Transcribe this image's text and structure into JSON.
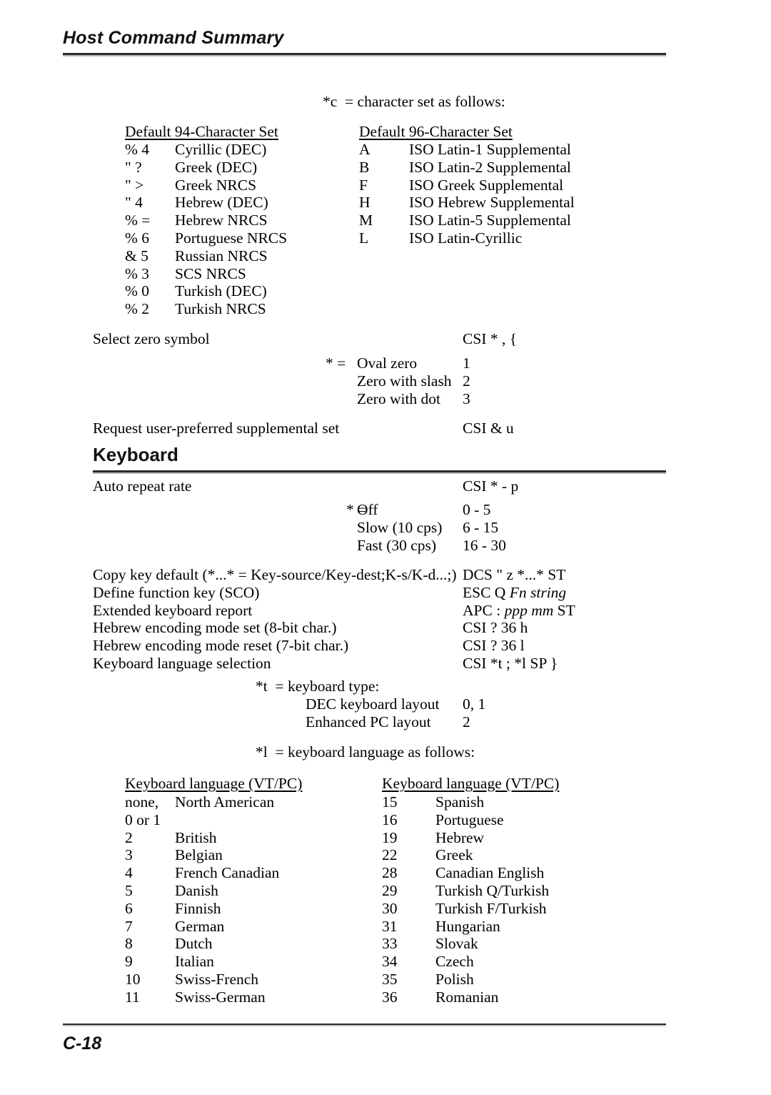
{
  "header": {
    "title": "Host Command Summary"
  },
  "footer": {
    "page_number": "C-18"
  },
  "charset_intro": "*c  = character set as follows:",
  "charset_table": {
    "left_header": "Default 94-Character Set",
    "right_header": "Default 96-Character Set",
    "left_rows": [
      {
        "code": "% 4",
        "name": "Cyrillic (DEC)"
      },
      {
        "code": "\" ?",
        "name": "Greek (DEC)"
      },
      {
        "code": "\" >",
        "name": "Greek NRCS"
      },
      {
        "code": "\" 4",
        "name": "Hebrew (DEC)"
      },
      {
        "code": "% =",
        "name": "Hebrew NRCS"
      },
      {
        "code": "% 6",
        "name": "Portuguese NRCS"
      },
      {
        "code": "& 5",
        "name": "Russian NRCS"
      },
      {
        "code": "% 3",
        "name": "SCS NRCS"
      },
      {
        "code": "% 0",
        "name": "Turkish (DEC)"
      },
      {
        "code": "% 2",
        "name": "Turkish NRCS"
      }
    ],
    "right_rows": [
      {
        "code": "A",
        "name": "ISO Latin-1 Supplemental"
      },
      {
        "code": "B",
        "name": "ISO Latin-2 Supplemental"
      },
      {
        "code": "F",
        "name": "ISO Greek Supplemental"
      },
      {
        "code": "H",
        "name": "ISO Hebrew Supplemental"
      },
      {
        "code": "M",
        "name": "ISO Latin-5 Supplemental"
      },
      {
        "code": "L",
        "name": "ISO Latin-Cyrillic"
      }
    ]
  },
  "zero_symbol": {
    "label": "Select zero symbol",
    "code": "CSI * , {",
    "options": [
      {
        "marker": "* =",
        "label": "Oval zero",
        "value": "1"
      },
      {
        "marker": "",
        "label": "Zero with slash",
        "value": "2"
      },
      {
        "marker": "",
        "label": "Zero with dot",
        "value": "3"
      }
    ]
  },
  "request_supplemental": {
    "label": "Request user-preferred supplemental set",
    "code": "CSI & u"
  },
  "keyboard_section": {
    "heading": "Keyboard",
    "auto_repeat": {
      "label": "Auto repeat rate",
      "code": "CSI * - p",
      "options": [
        {
          "marker": "* =",
          "label": "Off",
          "value": "0 - 5"
        },
        {
          "marker": "",
          "label": "Slow (10 cps)",
          "value": "6 - 15"
        },
        {
          "marker": "",
          "label": "Fast (30 cps)",
          "value": "16 - 30"
        }
      ]
    },
    "commands": [
      {
        "label": "Copy key default (*...* = Key-source/Key-dest;K-s/K-d...;)",
        "code": "DCS \" z *...* ST",
        "code_italic": ""
      },
      {
        "label": "Define function key (SCO)",
        "code": "ESC Q ",
        "code_italic": "Fn string"
      },
      {
        "label": "Extended keyboard report",
        "code": "APC : ",
        "code_italic": "ppp mm",
        "code_tail": " ST"
      },
      {
        "label": "Hebrew encoding mode set (8-bit char.)",
        "code": "CSI ? 36 h",
        "code_italic": ""
      },
      {
        "label": "Hebrew encoding mode reset (7-bit char.)",
        "code": "CSI ? 36 l",
        "code_italic": ""
      },
      {
        "label": "Keyboard language selection",
        "code": "CSI *t ; *l SP }",
        "code_italic": ""
      }
    ],
    "keyboard_type": {
      "intro": "*t  = keyboard type:",
      "rows": [
        {
          "label": "DEC keyboard layout",
          "value": "0, 1"
        },
        {
          "label": "Enhanced PC layout",
          "value": "2"
        }
      ]
    },
    "language_intro": "*l  = keyboard language as follows:",
    "language_table": {
      "left_header": "Keyboard language (VT/PC)",
      "right_header": "Keyboard language (VT/PC)",
      "left_rows": [
        {
          "code": "none,",
          "name": "North American"
        },
        {
          "code": "0 or 1",
          "name": ""
        },
        {
          "code": "2",
          "name": "British"
        },
        {
          "code": "3",
          "name": "Belgian"
        },
        {
          "code": "4",
          "name": "French Canadian"
        },
        {
          "code": "5",
          "name": "Danish"
        },
        {
          "code": "6",
          "name": "Finnish"
        },
        {
          "code": "7",
          "name": "German"
        },
        {
          "code": "8",
          "name": "Dutch"
        },
        {
          "code": "9",
          "name": "Italian"
        },
        {
          "code": "10",
          "name": "Swiss-French"
        },
        {
          "code": "11",
          "name": "Swiss-German"
        }
      ],
      "right_rows": [
        {
          "code": "15",
          "name": "Spanish"
        },
        {
          "code": "16",
          "name": "Portuguese"
        },
        {
          "code": "19",
          "name": "Hebrew"
        },
        {
          "code": "22",
          "name": "Greek"
        },
        {
          "code": "28",
          "name": "Canadian English"
        },
        {
          "code": "29",
          "name": "Turkish Q/Turkish"
        },
        {
          "code": "30",
          "name": "Turkish F/Turkish"
        },
        {
          "code": "31",
          "name": "Hungarian"
        },
        {
          "code": "33",
          "name": "Slovak"
        },
        {
          "code": "34",
          "name": "Czech"
        },
        {
          "code": "35",
          "name": "Polish"
        },
        {
          "code": "36",
          "name": "Romanian"
        }
      ]
    }
  }
}
